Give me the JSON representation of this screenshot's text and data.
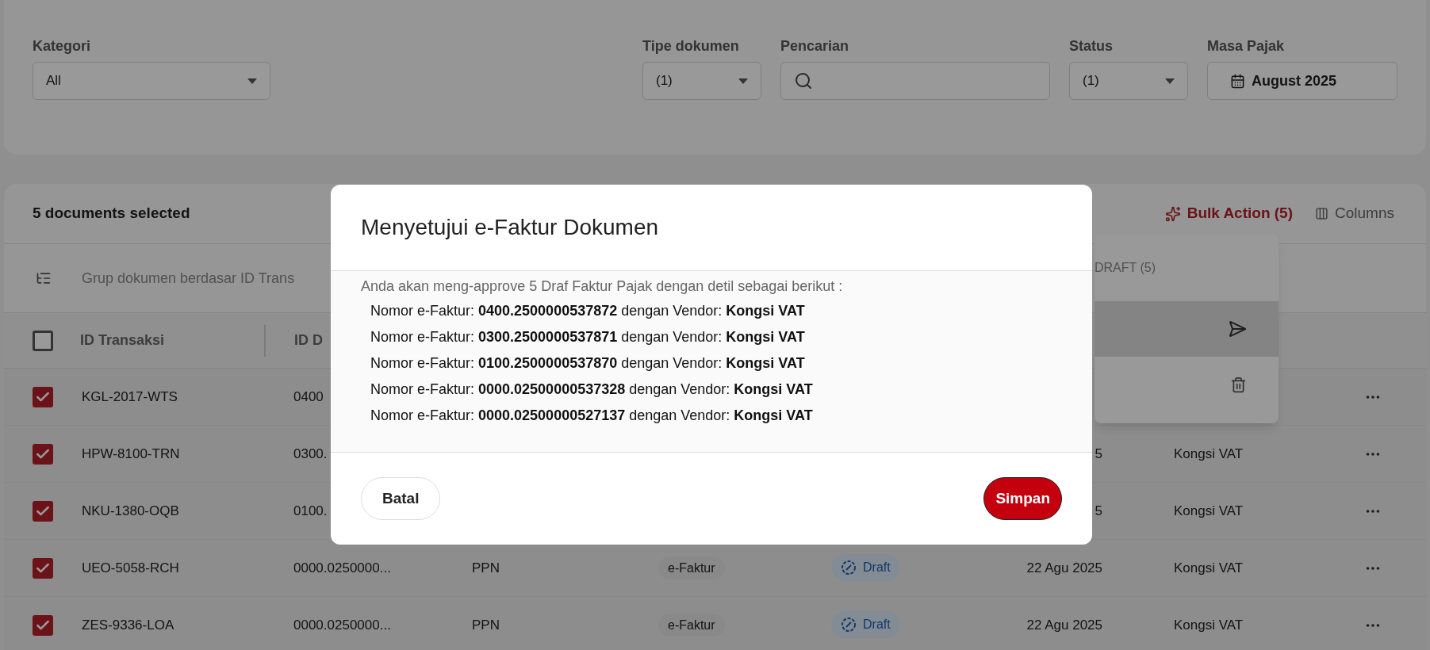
{
  "filters": [
    {
      "label": "Kategori",
      "kind": "select",
      "value": "All"
    },
    {
      "label": "Tipe dokumen",
      "kind": "select",
      "value": "(1)"
    },
    {
      "label": "Pencarian",
      "kind": "search"
    },
    {
      "label": "Status",
      "kind": "select",
      "value": "(1)"
    },
    {
      "label": "Masa Pajak",
      "kind": "date",
      "value": "August 2025"
    }
  ],
  "table": {
    "selection_text": "5 documents selected",
    "bulk_action": "Bulk Action (5)",
    "columns_button": "Columns",
    "group_hint": "Grup dokumen berdasar ID Trans",
    "select_all_checked": false,
    "columns": [
      "ID Transaksi",
      "ID D"
    ],
    "rows": [
      {
        "checked": true,
        "id": "KGL-2017-WTS",
        "doc_id": "0400"
      },
      {
        "checked": true,
        "id": "HPW-8100-TRN",
        "doc_id": "0300.",
        "date": "5",
        "vendor": "Kongsi VAT"
      },
      {
        "checked": true,
        "id": "NKU-1380-OQB",
        "doc_id": "0100.",
        "date": "5",
        "vendor": "Kongsi VAT"
      },
      {
        "checked": true,
        "id": "UEO-5058-RCH",
        "doc_id": "0000.0250000...",
        "tax": "PPN",
        "doc_type": "e-Faktur",
        "status": "Draft",
        "date": "22 Agu 2025",
        "vendor": "Kongsi VAT"
      },
      {
        "checked": true,
        "id": "ZES-9336-LOA",
        "doc_id": "0000.0250000...",
        "tax": "PPN",
        "doc_type": "e-Faktur",
        "status": "Draft",
        "date": "22 Agu 2025",
        "vendor": "Kongsi VAT"
      }
    ]
  },
  "bulk_menu": {
    "header": "DRAFT (5)",
    "items": [
      {
        "kind": "send",
        "selected": true
      },
      {
        "kind": "delete",
        "selected": false
      }
    ]
  },
  "dialog": {
    "title": "Menyetujui e-Faktur Dokumen",
    "intro": "Anda akan meng-approve 5 Draf Faktur Pajak dengan detil sebagai berikut :",
    "lines": [
      "Nomor e-Faktur: **0400.2500000537872** dengan Vendor: **Kongsi VAT**",
      "Nomor e-Faktur: **0300.2500000537871** dengan Vendor: **Kongsi VAT**",
      "Nomor e-Faktur: **0100.2500000537870** dengan Vendor: **Kongsi VAT**",
      "Nomor e-Faktur: **0000.02500000537328** dengan Vendor: **Kongsi VAT**",
      "Nomor e-Faktur: **0000.02500000527137** dengan Vendor: **Kongsi VAT**"
    ],
    "cancel": "Batal",
    "confirm": "Simpan"
  }
}
